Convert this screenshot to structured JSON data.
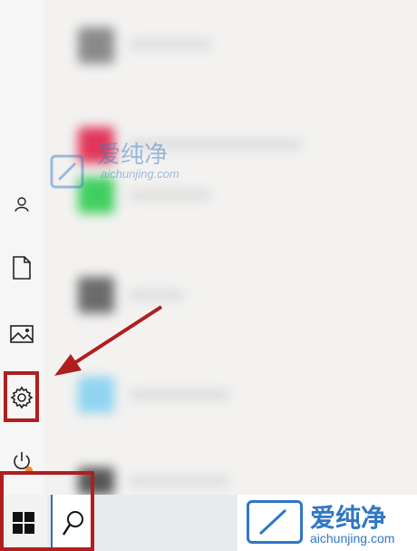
{
  "watermarks": {
    "center_cn": "爱纯净",
    "center_url": "aichunjing.com",
    "bottom_cn": "爱纯净",
    "bottom_url": "aichunjing.com"
  },
  "colors": {
    "highlight": "#b01e1e",
    "arrow": "#b01e1e",
    "watermark": "#2f77c7",
    "search_accent": "#2f6fa8"
  },
  "sidebar": {
    "items": [
      {
        "icon": "user-icon"
      },
      {
        "icon": "documents-icon"
      },
      {
        "icon": "pictures-icon"
      },
      {
        "icon": "settings-gear-icon"
      },
      {
        "icon": "power-icon"
      }
    ]
  },
  "taskbar": {
    "start_icon": "windows-logo-icon",
    "search_icon": "search-icon"
  }
}
